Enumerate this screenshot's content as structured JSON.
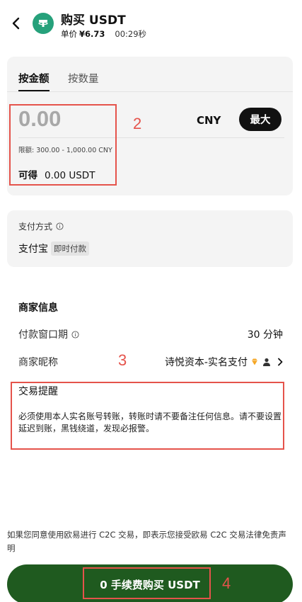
{
  "header": {
    "title": "购买 USDT",
    "price_label": "单价",
    "price_value": "¥6.73",
    "timer": "00:29秒"
  },
  "amount_card": {
    "tabs": [
      {
        "label": "按金额",
        "active": true
      },
      {
        "label": "按数量",
        "active": false
      }
    ],
    "input_placeholder": "0.00",
    "currency": "CNY",
    "max_label": "最大",
    "limit_text": "限额: 300.00 - 1,000.00 CNY",
    "receive_label": "可得",
    "receive_value": "0.00 USDT"
  },
  "payment": {
    "label": "支付方式",
    "method": "支付宝",
    "badge": "即时付款"
  },
  "merchant": {
    "section_title": "商家信息",
    "payment_window_label": "付款窗口期",
    "payment_window_value": "30 分钟",
    "nickname_label": "商家昵称",
    "nickname_value": "诗悦资本-实名支付",
    "reminder_title": "交易提醒",
    "reminder_text": "必须使用本人实名账号转账，转账时请不要备注任何信息。请不要设置延迟到账，黑钱绕道，发现必报警。"
  },
  "footer": {
    "disclaimer": "如果您同意使用欧易进行 C2C 交易，即表示您接受欧易 C2C 交易法律免责声明",
    "buy_button": "0 手续费购买 USDT"
  },
  "annotations": [
    {
      "number": "2"
    },
    {
      "number": "3"
    },
    {
      "number": "4"
    }
  ],
  "colors": {
    "tether_green": "#26a17b",
    "buy_button_bg": "#1f5a1f",
    "annotation_red": "#e5534b",
    "card_bg": "#f4f4f4"
  },
  "icons": [
    "back-arrow-icon",
    "tether-logo-icon",
    "info-icon",
    "diamond-icon",
    "user-icon",
    "chevron-right-icon"
  ]
}
